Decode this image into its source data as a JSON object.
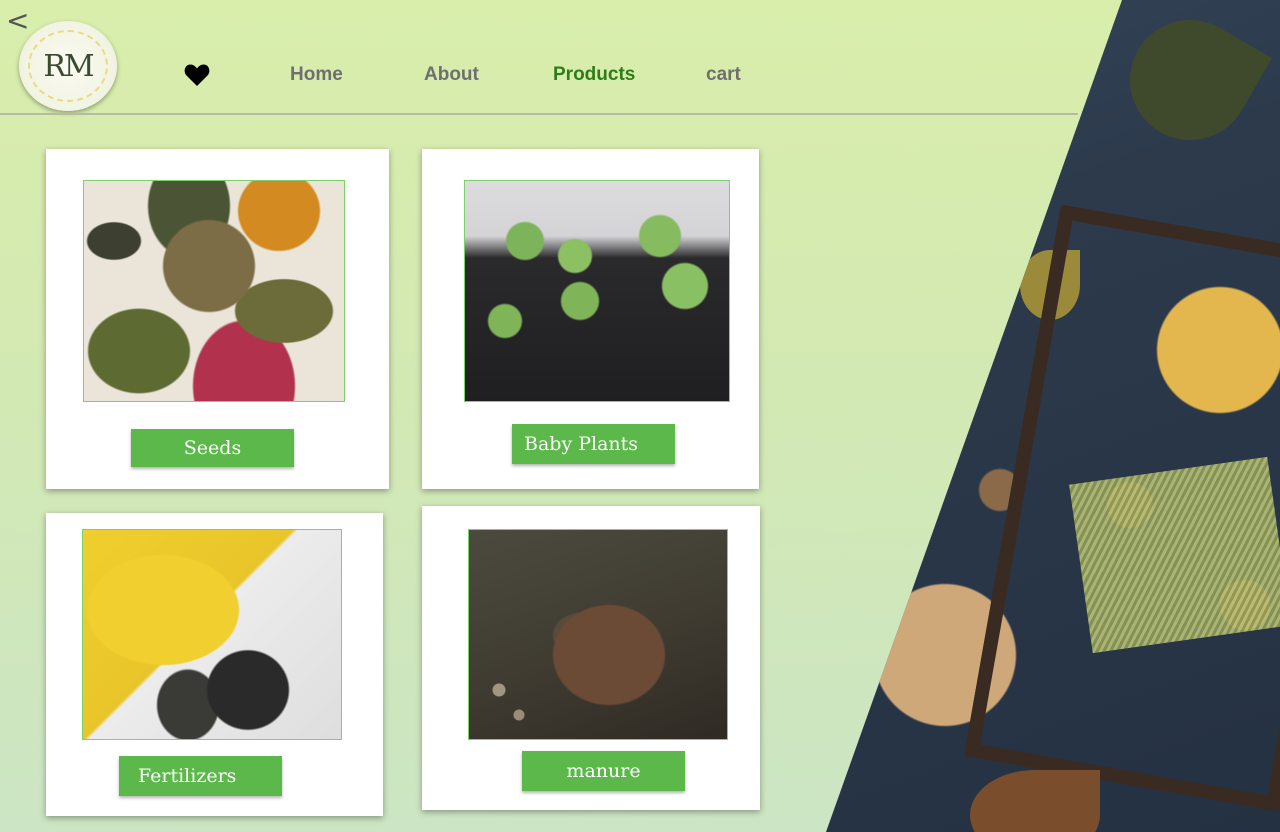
{
  "header": {
    "back_icon": "chevron-left-icon",
    "logo_text": "RM",
    "heart_icon": "heart-icon",
    "nav": [
      {
        "label": "Home",
        "active": false
      },
      {
        "label": "About",
        "active": false
      },
      {
        "label": "Products",
        "active": true
      },
      {
        "label": "cart",
        "active": false
      }
    ]
  },
  "products": [
    {
      "label": "Seeds",
      "image": "seed-sacks-photo"
    },
    {
      "label": "Baby Plants",
      "image": "seedling-tray-photo"
    },
    {
      "label": "Fertilizers",
      "image": "fertilizer-products-photo"
    },
    {
      "label": "manure",
      "image": "soil-in-hands-photo"
    }
  ],
  "colors": {
    "accent_green": "#5cb84a",
    "active_nav": "#2e7d1a",
    "background_top": "#d9eeab",
    "background_bottom": "#cce5c4"
  },
  "hero_image": "autumn-pumpkin-still-life-photo"
}
